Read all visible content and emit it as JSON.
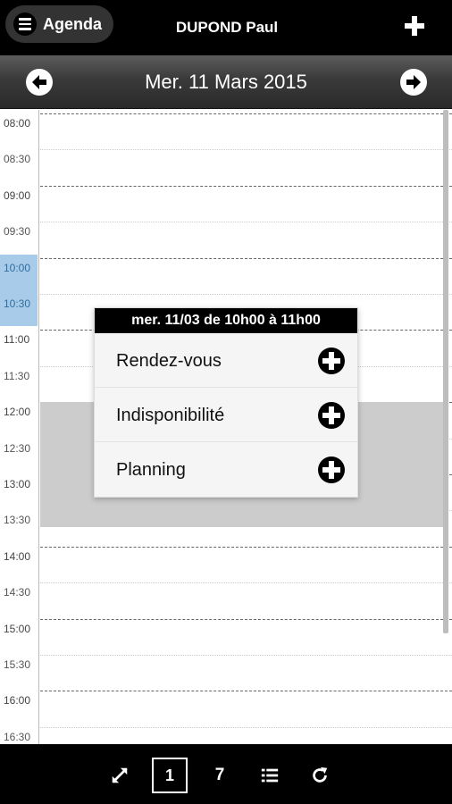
{
  "header": {
    "menu_label": "Agenda",
    "user_name": "DUPOND Paul"
  },
  "datebar": {
    "date": "Mer. 11 Mars 2015"
  },
  "calendar": {
    "slots": [
      "08:00",
      "08:30",
      "09:00",
      "09:30",
      "10:00",
      "10:30",
      "11:00",
      "11:30",
      "12:00",
      "12:30",
      "13:00",
      "13:30",
      "14:00",
      "14:30",
      "15:00",
      "15:30",
      "16:00",
      "16:30"
    ],
    "selected_slots": [
      "10:00",
      "10:30"
    ],
    "unavailable_range": "12:00 - 13:30"
  },
  "popup": {
    "title": "mer. 11/03 de 10h00 à 11h00",
    "items": [
      {
        "label": "Rendez-vous"
      },
      {
        "label": "Indisponibilité"
      },
      {
        "label": "Planning"
      }
    ]
  },
  "toolbar": {
    "day_label": "1",
    "week_label": "7"
  },
  "colors": {
    "bar_background": "#000000",
    "selected_slot": "#a7cbe8",
    "unavailable_block": "#cccccc"
  },
  "icons": {
    "menu": "hamburger-icon",
    "add": "plus-icon",
    "prev": "arrow-left-icon",
    "next": "arrow-right-icon",
    "item_add": "plus-circle-icon",
    "expand": "expand-icon",
    "list": "list-icon",
    "refresh": "refresh-icon"
  }
}
